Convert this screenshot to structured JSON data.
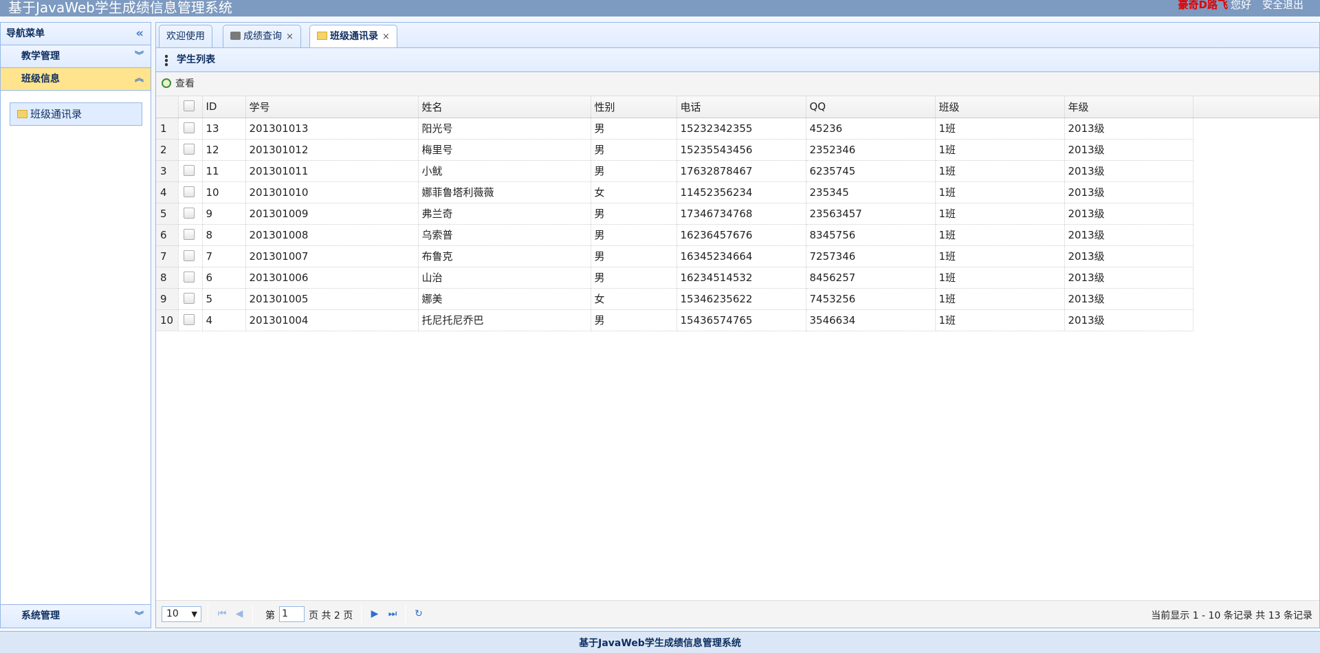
{
  "header": {
    "app_title": "基于JavaWeb学生成绩信息管理系统",
    "user_name": "豪奇D路飞",
    "greeting": "您好",
    "logout": "安全退出"
  },
  "sidebar": {
    "title": "导航菜单",
    "groups": [
      {
        "label": "教学管理",
        "expanded": false
      },
      {
        "label": "班级信息",
        "expanded": true
      }
    ],
    "links": [
      {
        "label": "班级通讯录"
      }
    ],
    "bottom_group": "系统管理"
  },
  "tabs": [
    {
      "label": "欢迎使用",
      "closable": false,
      "icon": null
    },
    {
      "label": "成绩查询",
      "closable": true,
      "icon": "grid-icon"
    },
    {
      "label": "班级通讯录",
      "closable": true,
      "icon": "folder-icon",
      "selected": true
    }
  ],
  "panel": {
    "title": "学生列表",
    "toolbar_view": "查看"
  },
  "table": {
    "columns": [
      "ID",
      "学号",
      "姓名",
      "性别",
      "电话",
      "QQ",
      "班级",
      "年级"
    ],
    "rows": [
      [
        "13",
        "201301013",
        "阳光号",
        "男",
        "15232342355",
        "45236",
        "1班",
        "2013级"
      ],
      [
        "12",
        "201301012",
        "梅里号",
        "男",
        "15235543456",
        "2352346",
        "1班",
        "2013级"
      ],
      [
        "11",
        "201301011",
        "小鱿",
        "男",
        "17632878467",
        "6235745",
        "1班",
        "2013级"
      ],
      [
        "10",
        "201301010",
        "娜菲鲁塔利薇薇",
        "女",
        "11452356234",
        "235345",
        "1班",
        "2013级"
      ],
      [
        "9",
        "201301009",
        "弗兰奇",
        "男",
        "17346734768",
        "23563457",
        "1班",
        "2013级"
      ],
      [
        "8",
        "201301008",
        "乌索普",
        "男",
        "16236457676",
        "8345756",
        "1班",
        "2013级"
      ],
      [
        "7",
        "201301007",
        "布鲁克",
        "男",
        "16345234664",
        "7257346",
        "1班",
        "2013级"
      ],
      [
        "6",
        "201301006",
        "山治",
        "男",
        "16234514532",
        "8456257",
        "1班",
        "2013级"
      ],
      [
        "5",
        "201301005",
        "娜美",
        "女",
        "15346235622",
        "7453256",
        "1班",
        "2013级"
      ],
      [
        "4",
        "201301004",
        "托尼托尼乔巴",
        "男",
        "15436574765",
        "3546634",
        "1班",
        "2013级"
      ]
    ]
  },
  "pager": {
    "page_size": "10",
    "page_prefix": "第",
    "current_page": "1",
    "page_suffix": "页 共 2 页",
    "info": "当前显示 1 - 10 条记录 共 13 条记录"
  },
  "footer": {
    "text": "基于JavaWeb学生成绩信息管理系统"
  }
}
